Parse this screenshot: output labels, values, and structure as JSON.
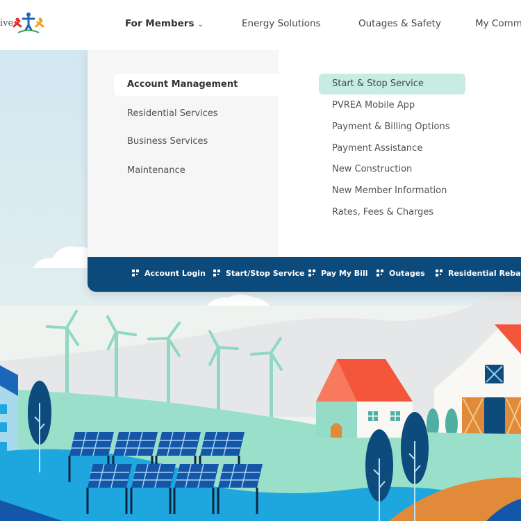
{
  "header": {
    "logo_text": "ive",
    "nav": [
      {
        "label": "For Members",
        "active": true,
        "has_dropdown": true
      },
      {
        "label": "Energy Solutions",
        "active": false
      },
      {
        "label": "Outages & Safety",
        "active": false
      },
      {
        "label": "My Comm",
        "active": false
      }
    ]
  },
  "menu": {
    "categories": [
      {
        "label": "Account Management",
        "active": true
      },
      {
        "label": "Residential Services",
        "active": false
      },
      {
        "label": "Business Services",
        "active": false
      },
      {
        "label": "Maintenance",
        "active": false
      }
    ],
    "subitems": [
      {
        "label": "Start & Stop Service",
        "active": true
      },
      {
        "label": "PVREA Mobile App",
        "active": false
      },
      {
        "label": "Payment & Billing Options",
        "active": false
      },
      {
        "label": "Payment Assistance",
        "active": false
      },
      {
        "label": "New Construction",
        "active": false
      },
      {
        "label": "New Member Information",
        "active": false
      },
      {
        "label": "Rates, Fees & Charges",
        "active": false
      }
    ],
    "quick_links": [
      {
        "label": "Account Login",
        "icon": "qr-grid-icon"
      },
      {
        "label": "Start/Stop Service",
        "icon": "qr-grid-icon"
      },
      {
        "label": "Pay My Bill",
        "icon": "qr-grid-icon"
      },
      {
        "label": "Outages",
        "icon": "qr-grid-icon"
      },
      {
        "label": "Residential Rebate",
        "icon": "qr-grid-icon"
      }
    ]
  },
  "colors": {
    "quickbar": "#0c4a7b",
    "active_subitem": "#c9ece2",
    "roof": "#f4563a",
    "turbine": "#8fd8c2",
    "hill_green": "#9adfc9",
    "water_blue": "#1ea7de",
    "solar_blue": "#1457a8",
    "barn_orange": "#e08a3a",
    "tree_navy": "#0e4b7d"
  }
}
